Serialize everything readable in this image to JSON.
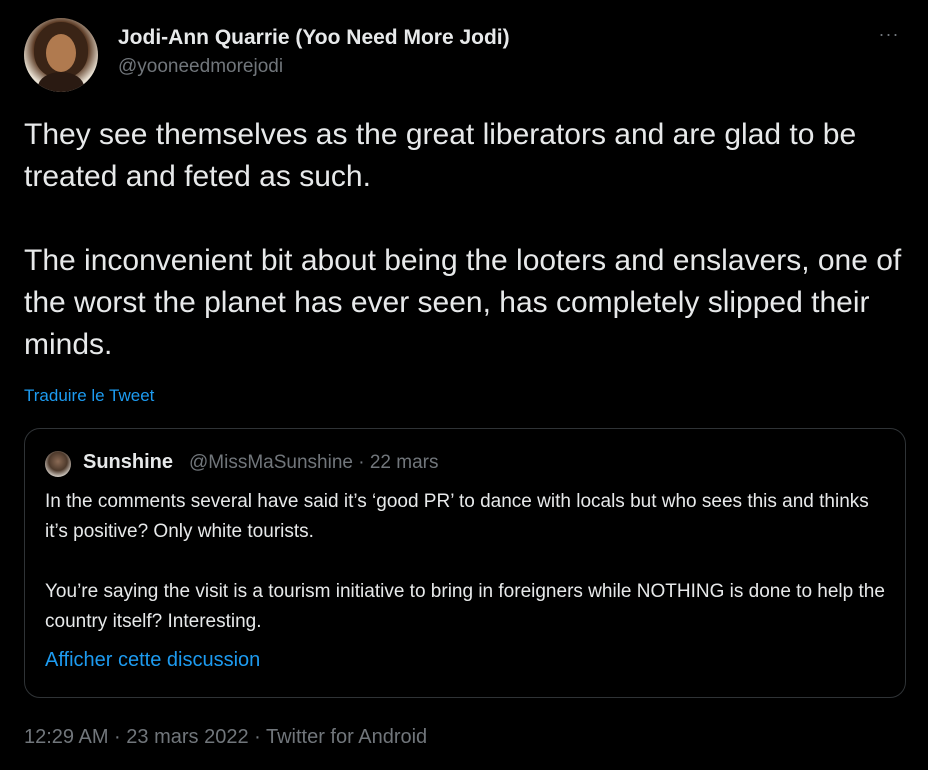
{
  "tweet": {
    "author": {
      "name": "Jodi-Ann Quarrie (Yoo Need More Jodi)",
      "handle": "@yooneedmorejodi"
    },
    "more_label": "···",
    "body": {
      "paragraph1": "They see themselves as the great liberators and are glad to be treated and feted as such.",
      "paragraph2": "The inconvenient bit about being the looters and enslavers, one of the worst the planet has ever seen, has completely slipped their minds."
    },
    "translate_label": "Traduire le Tweet",
    "quote": {
      "name": "Sunshine",
      "meta": "@MissMaSunshine · 22 mars",
      "paragraph1": "In the comments several have said it’s ‘good PR’ to dance with locals but who sees this and thinks it’s positive? Only white tourists.",
      "paragraph2": "You’re saying the visit is a tourism initiative to bring in foreigners while NOTHING is done to help the country itself?  Interesting.",
      "show_thread_label": "Afficher cette discussion"
    },
    "footer": "12:29 AM · 23 mars 2022 · Twitter for Android"
  },
  "colors": {
    "background": "#000000",
    "text": "#e7e9ea",
    "secondary": "#71767b",
    "link": "#1d9bf0",
    "border": "#2f3336"
  }
}
